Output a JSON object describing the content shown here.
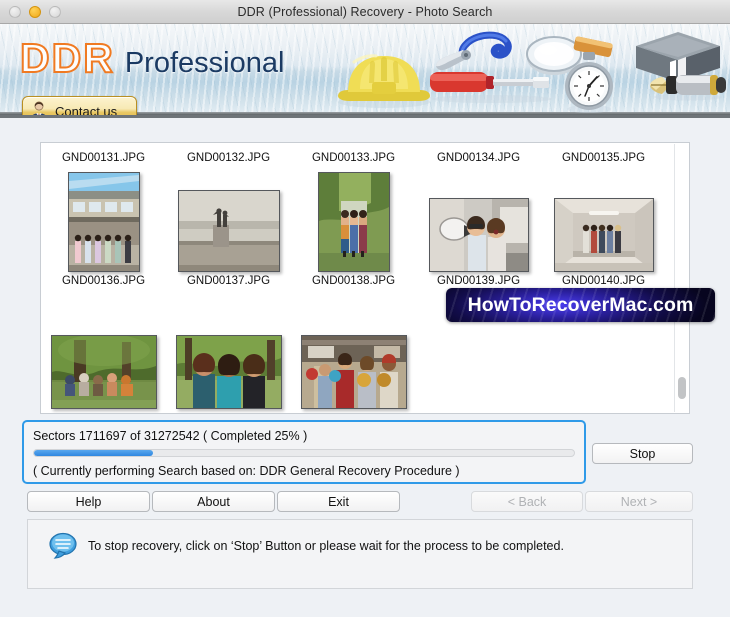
{
  "window": {
    "title": "DDR (Professional) Recovery - Photo Search",
    "traffic_lights": {
      "close": "close-button",
      "minimize": "minimize-button",
      "zoom": "zoom-button"
    }
  },
  "header": {
    "logo_primary": "DDR",
    "logo_secondary": "Professional",
    "contact_button": "Contact us",
    "colors": {
      "logo_orange": "#f07a22",
      "logo_navy": "#1b3a63",
      "button_gold": "#e9c863"
    },
    "tool_icons": [
      "hard-hat-icon",
      "pliers-icon",
      "screwdriver-icon",
      "magnifier-icon",
      "stopwatch-icon",
      "book-icon",
      "fountain-pen-icon"
    ]
  },
  "file_list": {
    "rows": [
      {
        "names": [
          "GND00131.JPG",
          "GND00132.JPG",
          "GND00133.JPG",
          "GND00134.JPG",
          "GND00135.JPG"
        ],
        "thumbnails": [
          "group-under-bridge",
          "people-on-rooftop",
          "three-women-garden-path",
          "women-with-megaphone",
          "group-in-corridor"
        ]
      },
      {
        "names": [
          "GND00136.JPG",
          "GND00137.JPG",
          "GND00138.JPG",
          "GND00139.JPG",
          "GND00140.JPG"
        ],
        "thumbnails": [
          "friends-picnic-park",
          "three-women-park",
          "friends-bowling-alley",
          "",
          ""
        ]
      }
    ],
    "scrollbar_position": "near-bottom"
  },
  "progress": {
    "sectors_text": "Sectors 1711697 of 31272542   ( Completed 25% )",
    "sectors_current": 1711697,
    "sectors_total": 31272542,
    "percent_complete": 25,
    "bar_fill_percent": 22,
    "status_text": "( Currently performing Search based on: DDR General Recovery Procedure )",
    "border_color": "#2f9ae8",
    "fill_color": "#2f87e0"
  },
  "buttons": {
    "stop": "Stop",
    "help": "Help",
    "about": "About",
    "exit": "Exit",
    "back": "< Back",
    "next": "Next >",
    "back_enabled": false,
    "next_enabled": false
  },
  "info": {
    "icon": "speech-bubble-icon",
    "message": "To stop recovery, click on ‘Stop’ Button or please wait for the process to be completed."
  },
  "watermark": {
    "text": "HowToRecoverMac.com"
  }
}
